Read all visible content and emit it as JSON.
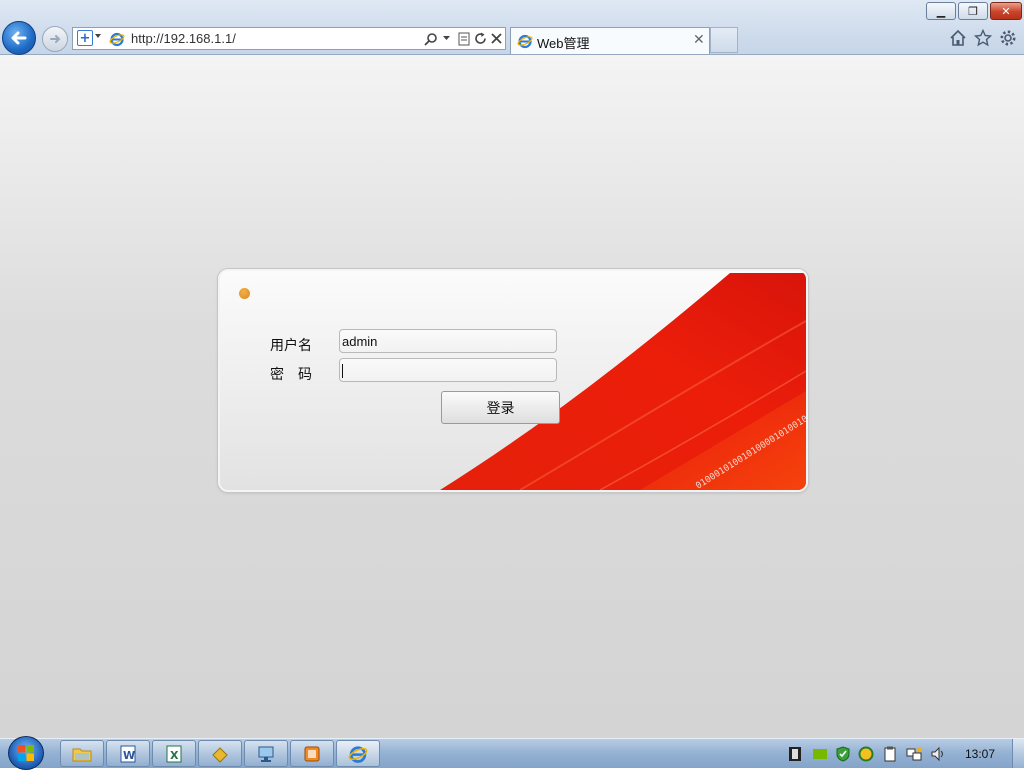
{
  "browser": {
    "address_url": "http://192.168.1.1/",
    "tab_title": "Web管理",
    "window_buttons": {
      "minimize": "▁",
      "restore": "❐",
      "close": "✕"
    }
  },
  "login": {
    "username_label": "用户名",
    "password_label": "密　码",
    "username_value": "admin",
    "password_value": "",
    "login_button": "登录",
    "binary_text": "0100010100101000010100101001010101011"
  },
  "colors": {
    "accent_red": "#e8210a",
    "dot_orange": "#e29a2e",
    "taskbar_blue": "#93b1d3"
  },
  "taskbar": {
    "apps": [
      {
        "name": "file-explorer-icon"
      },
      {
        "name": "word-icon"
      },
      {
        "name": "excel-icon"
      },
      {
        "name": "folder-app-icon"
      },
      {
        "name": "remote-desktop-icon"
      },
      {
        "name": "media-app-icon"
      },
      {
        "name": "internet-explorer-icon"
      }
    ],
    "clock": "13:07"
  }
}
